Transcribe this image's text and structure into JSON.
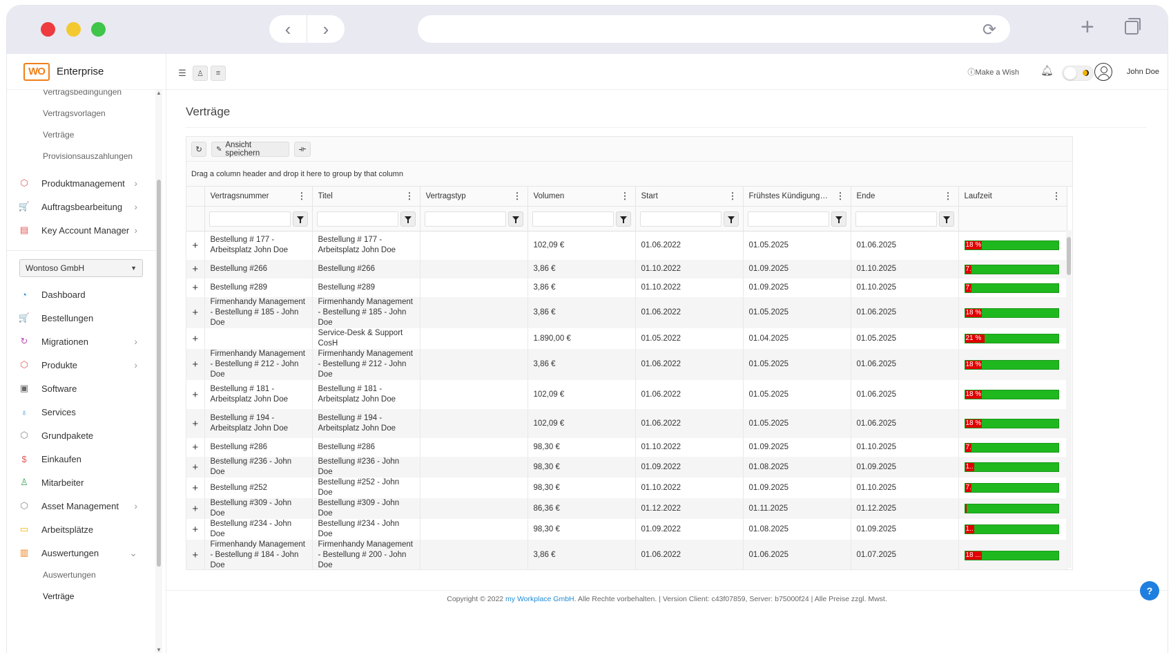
{
  "browser": {
    "back": "‹",
    "forward": "›",
    "reload": "⟳",
    "newtab": "+"
  },
  "brand": {
    "logo": "WO",
    "name": "Enterprise"
  },
  "sidebar": {
    "top_subitems": [
      "Vertragsbedingungen",
      "Vertragsvorlagen",
      "Verträge",
      "Provisionsauszahlungen"
    ],
    "top_items": [
      {
        "label": "Produktmanagement",
        "icon": "cube-icon",
        "glyph": "⬡",
        "color": "#e15a5a",
        "chevron": "›"
      },
      {
        "label": "Auftragsbearbeitung",
        "icon": "cart-icon",
        "glyph": "🛒",
        "color": "#e15a5a",
        "chevron": "›"
      },
      {
        "label": "Key Account Manager",
        "icon": "contract-icon",
        "glyph": "▤",
        "color": "#e15a5a",
        "chevron": "›"
      }
    ],
    "tenant": "Wontoso GmbH",
    "items": [
      {
        "label": "Dashboard",
        "icon": "dashboard-icon",
        "glyph": "◔",
        "color": "#2f8fd8",
        "chevron": ""
      },
      {
        "label": "Bestellungen",
        "icon": "cart-icon",
        "glyph": "🛒",
        "color": "#e15a5a",
        "chevron": ""
      },
      {
        "label": "Migrationen",
        "icon": "refresh-icon",
        "glyph": "↻",
        "color": "#b84fb8",
        "chevron": "›"
      },
      {
        "label": "Produkte",
        "icon": "cube-icon",
        "glyph": "⬡",
        "color": "#e15a5a",
        "chevron": "›"
      },
      {
        "label": "Software",
        "icon": "floppy-icon",
        "glyph": "▣",
        "color": "#666666",
        "chevron": ""
      },
      {
        "label": "Services",
        "icon": "bulb-icon",
        "glyph": "♁",
        "color": "#2f8fd8",
        "chevron": ""
      },
      {
        "label": "Grundpakete",
        "icon": "package-icon",
        "glyph": "⬡",
        "color": "#888888",
        "chevron": ""
      },
      {
        "label": "Einkaufen",
        "icon": "dollar-icon",
        "glyph": "$",
        "color": "#e15a5a",
        "chevron": ""
      },
      {
        "label": "Mitarbeiter",
        "icon": "user-icon",
        "glyph": "♙",
        "color": "#3aa55a",
        "chevron": ""
      },
      {
        "label": "Asset Management",
        "icon": "box-icon",
        "glyph": "⬡",
        "color": "#888888",
        "chevron": "›"
      },
      {
        "label": "Arbeitsplätze",
        "icon": "monitor-icon",
        "glyph": "▭",
        "color": "#f0b400",
        "chevron": ""
      },
      {
        "label": "Auswertungen",
        "icon": "chart-icon",
        "glyph": "▥",
        "color": "#f07f1a",
        "chevron": "⌄"
      }
    ],
    "bottom_subitems": [
      "Auswertungen",
      "Verträge"
    ]
  },
  "topbar": {
    "wish": "Make a Wish",
    "user": "John Doe"
  },
  "page": {
    "title": "Verträge"
  },
  "grid": {
    "save_view": "Ansicht speichern",
    "group_hint": "Drag a column header and drop it here to group by that column",
    "columns": [
      "Vertragsnummer",
      "Titel",
      "Vertragstyp",
      "Volumen",
      "Start",
      "Frühstes Kündigungsd...",
      "Ende",
      "Laufzeit"
    ],
    "rows": [
      {
        "nr": "Bestellung # 177 - Arbeitsplatz John Doe",
        "titel": "Bestellung # 177 - Arbeitsplatz John Doe",
        "typ": "",
        "vol": "102,09 €",
        "start": "01.06.2022",
        "kd": "01.05.2025",
        "ende": "01.06.2025",
        "lz": "18 %",
        "lzp": 0.18
      },
      {
        "nr": "Bestellung #266",
        "titel": "Bestellung #266",
        "typ": "",
        "vol": "3,86 €",
        "start": "01.10.2022",
        "kd": "01.09.2025",
        "ende": "01.10.2025",
        "lz": "7.",
        "lzp": 0.07
      },
      {
        "nr": "Bestellung #289",
        "titel": "Bestellung #289",
        "typ": "",
        "vol": "3,86 €",
        "start": "01.10.2022",
        "kd": "01.09.2025",
        "ende": "01.10.2025",
        "lz": "7.",
        "lzp": 0.07
      },
      {
        "nr": "Firmenhandy Management - Bestellung # 185 - John Doe",
        "titel": "Firmenhandy Management - Bestellung # 185 - John Doe",
        "typ": "",
        "vol": "3,86 €",
        "start": "01.06.2022",
        "kd": "01.05.2025",
        "ende": "01.06.2025",
        "lz": "18 %",
        "lzp": 0.18
      },
      {
        "nr": "",
        "titel": "Service-Desk & Support CosH",
        "typ": "",
        "vol": "1.890,00 €",
        "start": "01.05.2022",
        "kd": "01.04.2025",
        "ende": "01.05.2025",
        "lz": "21 %",
        "lzp": 0.21
      },
      {
        "nr": "Firmenhandy Management - Bestellung # 212 - John Doe",
        "titel": "Firmenhandy Management - Bestellung # 212 - John Doe",
        "typ": "",
        "vol": "3,86 €",
        "start": "01.06.2022",
        "kd": "01.05.2025",
        "ende": "01.06.2025",
        "lz": "18 %",
        "lzp": 0.18
      },
      {
        "nr": "Bestellung # 181 - Arbeitsplatz John Doe",
        "titel": "Bestellung # 181 - Arbeitsplatz John Doe",
        "typ": "",
        "vol": "102,09 €",
        "start": "01.06.2022",
        "kd": "01.05.2025",
        "ende": "01.06.2025",
        "lz": "18 %",
        "lzp": 0.18
      },
      {
        "nr": "Bestellung # 194 - Arbeitsplatz John Doe",
        "titel": "Bestellung # 194 - Arbeitsplatz John Doe",
        "typ": "",
        "vol": "102,09 €",
        "start": "01.06.2022",
        "kd": "01.05.2025",
        "ende": "01.06.2025",
        "lz": "18 %",
        "lzp": 0.18
      },
      {
        "nr": "Bestellung #286",
        "titel": "Bestellung #286",
        "typ": "",
        "vol": "98,30 €",
        "start": "01.10.2022",
        "kd": "01.09.2025",
        "ende": "01.10.2025",
        "lz": "7.",
        "lzp": 0.07
      },
      {
        "nr": "Bestellung #236 - John Doe",
        "titel": "Bestellung #236 - John Doe",
        "typ": "",
        "vol": "98,30 €",
        "start": "01.09.2022",
        "kd": "01.08.2025",
        "ende": "01.09.2025",
        "lz": "1..",
        "lzp": 0.1
      },
      {
        "nr": "Bestellung #252",
        "titel": "Bestellung #252 - John Doe",
        "typ": "",
        "vol": "98,30 €",
        "start": "01.10.2022",
        "kd": "01.09.2025",
        "ende": "01.10.2025",
        "lz": "7.",
        "lzp": 0.07
      },
      {
        "nr": "Bestellung #309 - John Doe",
        "titel": "Bestellung #309 - John Doe",
        "typ": "",
        "vol": "86,36 €",
        "start": "01.12.2022",
        "kd": "01.11.2025",
        "ende": "01.12.2025",
        "lz": "",
        "lzp": 0.02
      },
      {
        "nr": "Bestellung #234 - John Doe",
        "titel": "Bestellung #234 - John Doe",
        "typ": "",
        "vol": "98,30 €",
        "start": "01.09.2022",
        "kd": "01.08.2025",
        "ende": "01.09.2025",
        "lz": "1..",
        "lzp": 0.1
      },
      {
        "nr": "Firmenhandy Management - Bestellung # 184 - John Doe",
        "titel": "Firmenhandy Management - Bestellung # 200 - John Doe",
        "typ": "",
        "vol": "3,86 €",
        "start": "01.06.2022",
        "kd": "01.06.2025",
        "ende": "01.07.2025",
        "lz": "18 ...",
        "lzp": 0.18
      }
    ]
  },
  "footer": {
    "prefix": "Copyright © 2022 ",
    "company": "my Workplace GmbH",
    "suffix": ". Alle Rechte vorbehalten. | Version Client: c43f07859, Server: b75000f24 | Alle Preise zzgl. Mwst."
  },
  "colors": {
    "progress_done": "#e00000",
    "progress_rest": "#1fb81f",
    "link": "#1f8bd6"
  }
}
